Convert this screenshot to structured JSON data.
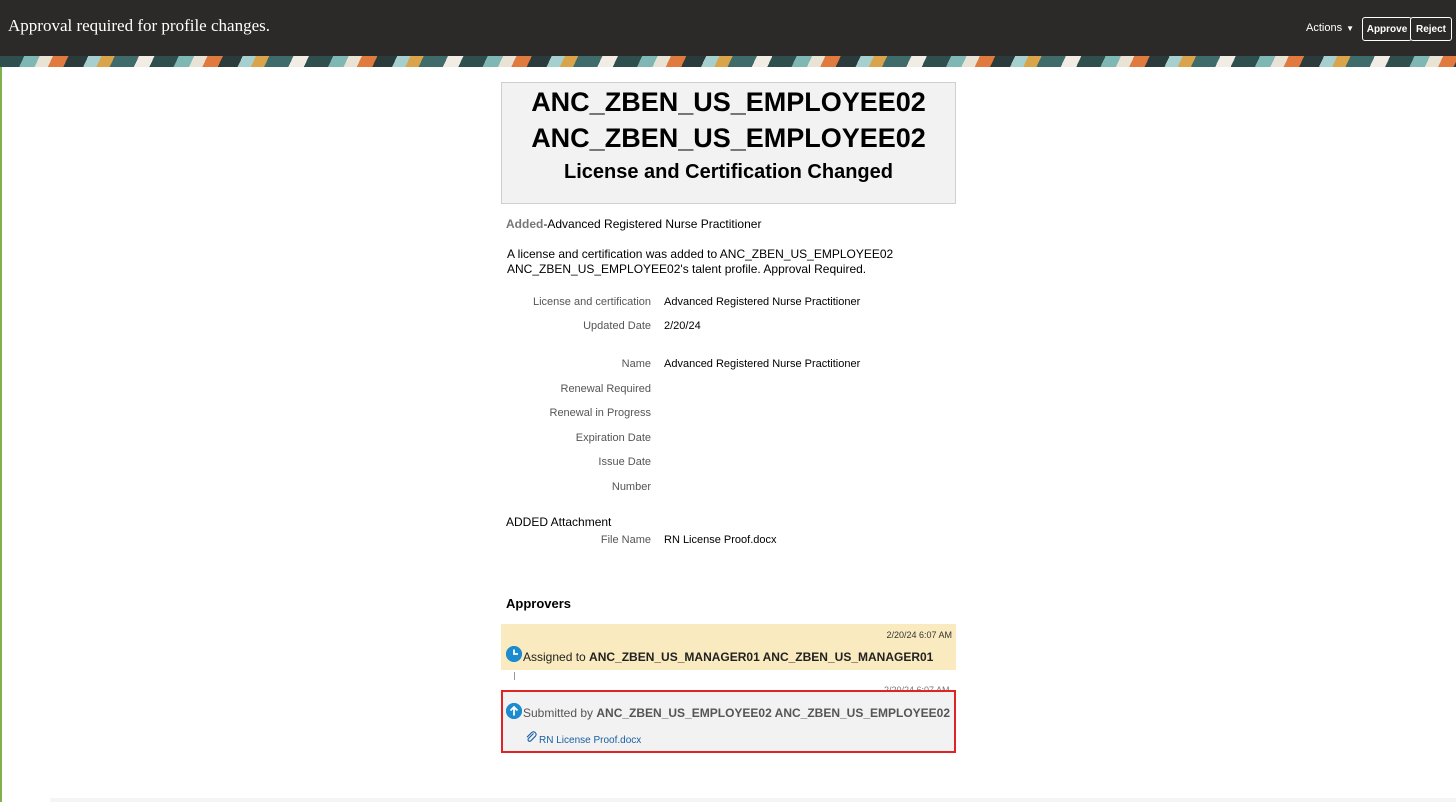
{
  "header": {
    "title": "Approval required for profile changes.",
    "actions_label": "Actions",
    "approve_label": "Approve",
    "reject_label": "Reject"
  },
  "summary": {
    "line1": "ANC_ZBEN_US_EMPLOYEE02",
    "line2": "ANC_ZBEN_US_EMPLOYEE02",
    "subtitle": "License and Certification Changed"
  },
  "change": {
    "tag": "Added",
    "item": "-Advanced Registered Nurse Practitioner",
    "description_1": "A license and certification was added to ANC_ZBEN_US_EMPLOYEE02",
    "description_2": "ANC_ZBEN_US_EMPLOYEE02's talent profile. Approval Required."
  },
  "fields": {
    "license_label": "License and certification",
    "license_value": "Advanced Registered Nurse Practitioner",
    "updated_label": "Updated Date",
    "updated_value": "2/20/24",
    "name_label": "Name",
    "name_value": "Advanced Registered Nurse Practitioner",
    "renewal_required_label": "Renewal Required",
    "renewal_in_progress_label": "Renewal in Progress",
    "expiration_label": "Expiration Date",
    "issue_label": "Issue Date",
    "number_label": "Number"
  },
  "attachment": {
    "heading": "ADDED Attachment",
    "file_label": "File Name",
    "file_value": "RN License Proof.docx"
  },
  "approvers": {
    "title": "Approvers",
    "assigned": {
      "timestamp": "2/20/24 6:07 AM",
      "prefix": "Assigned to ",
      "name": "ANC_ZBEN_US_MANAGER01 ANC_ZBEN_US_MANAGER01"
    },
    "submitted": {
      "timestamp": "2/20/24 6:07 AM",
      "prefix": "Submitted by ",
      "name": "ANC_ZBEN_US_EMPLOYEE02 ANC_ZBEN_US_EMPLOYEE02",
      "attachment_link": "RN License Proof.docx"
    }
  },
  "icons": {
    "assigned": "clock-icon",
    "submitted": "arrow-up-icon",
    "attachment": "paperclip-icon"
  },
  "colors": {
    "topbar": "#2b2a28",
    "assigned_bg": "#f9ebbf",
    "highlight_border": "#e02424",
    "link": "#1a5fa3",
    "status_icon": "#1d8bd0"
  }
}
